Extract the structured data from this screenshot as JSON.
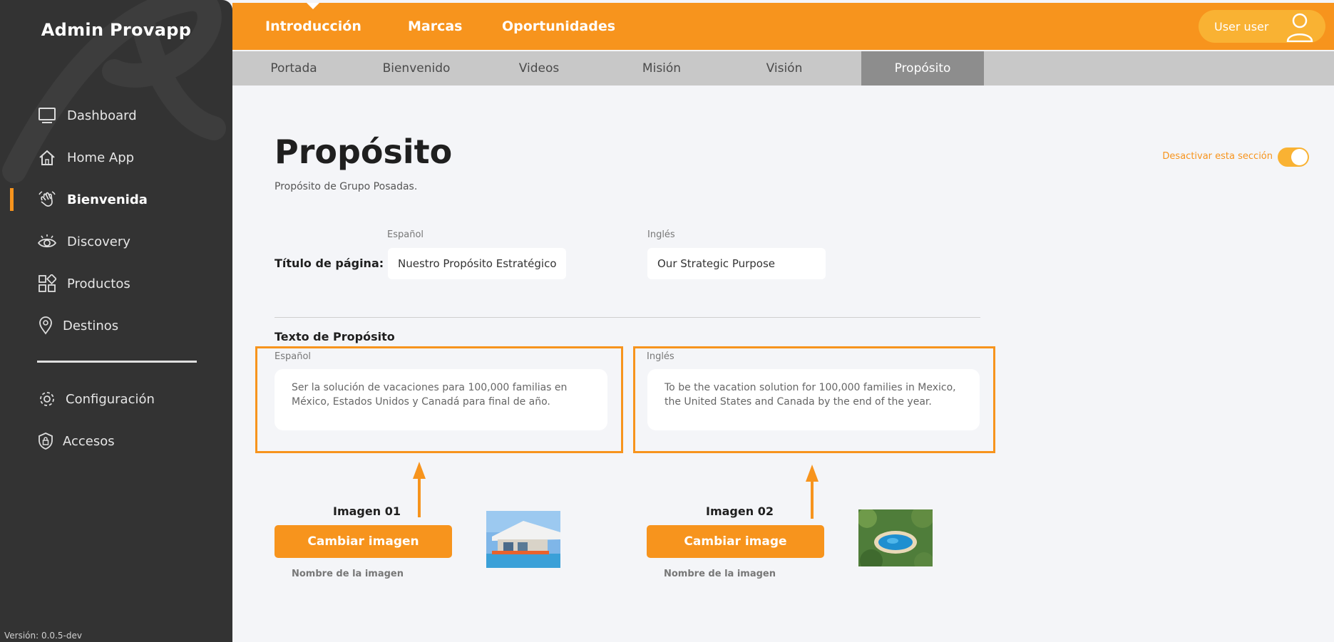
{
  "sidebar": {
    "brand": "Admin Provapp",
    "items": [
      {
        "label": "Dashboard",
        "icon": "monitor-icon"
      },
      {
        "label": "Home App",
        "icon": "house-icon"
      },
      {
        "label": "Bienvenida",
        "icon": "waving-hand-icon",
        "active": true
      },
      {
        "label": "Discovery",
        "icon": "eye-icon"
      },
      {
        "label": "Productos",
        "icon": "grid-shapes-icon"
      },
      {
        "label": "Destinos",
        "icon": "map-pin-icon"
      }
    ],
    "bottom_items": [
      {
        "label": "Configuración",
        "icon": "gear-icon"
      },
      {
        "label": "Accesos",
        "icon": "shield-lock-icon"
      }
    ],
    "version": "Versión: 0.0.5-dev"
  },
  "topbar": {
    "tabs": [
      "Introducción",
      "Marcas",
      "Oportunidades"
    ],
    "user_name": "User user"
  },
  "subtabs": {
    "items": [
      "Portada",
      "Bienvenido",
      "Videos",
      "Misión",
      "Visión",
      "Propósito"
    ],
    "active": "Propósito"
  },
  "page": {
    "title": "Propósito",
    "subtitle": "Propósito de Grupo Posadas.",
    "toggle_label": "Desactivar esta sección",
    "toggle_on": true
  },
  "title_row": {
    "label": "Título de página:",
    "lang_es": "Español",
    "lang_en": "Inglés",
    "value_es": "Nuestro Propósito Estratégico",
    "value_en": "Our Strategic Purpose"
  },
  "purpose_text": {
    "section_title": "Texto de Propósito",
    "lang_es": "Español",
    "lang_en": "Inglés",
    "value_es": "Ser la solución de vacaciones para 100,000 familias en México, Estados Unidos y Canadá para final de año.",
    "value_en": "To be the vacation solution for 100,000 families in Mexico, the United States and Canada by the end of the year."
  },
  "images": [
    {
      "title": "Imagen 01",
      "button": "Cambiar imagen",
      "name_label": "Nombre de la imagen"
    },
    {
      "title": "Imagen 02",
      "button": "Cambiar image",
      "name_label": "Nombre de la imagen"
    }
  ],
  "colors": {
    "accent": "#f7941d",
    "accent_light": "#f9b233",
    "sidebar_bg": "#333333",
    "subtab_bg": "#c8c8c8",
    "subtab_active_bg": "#8d8d8d",
    "content_bg": "#f4f5f8"
  }
}
